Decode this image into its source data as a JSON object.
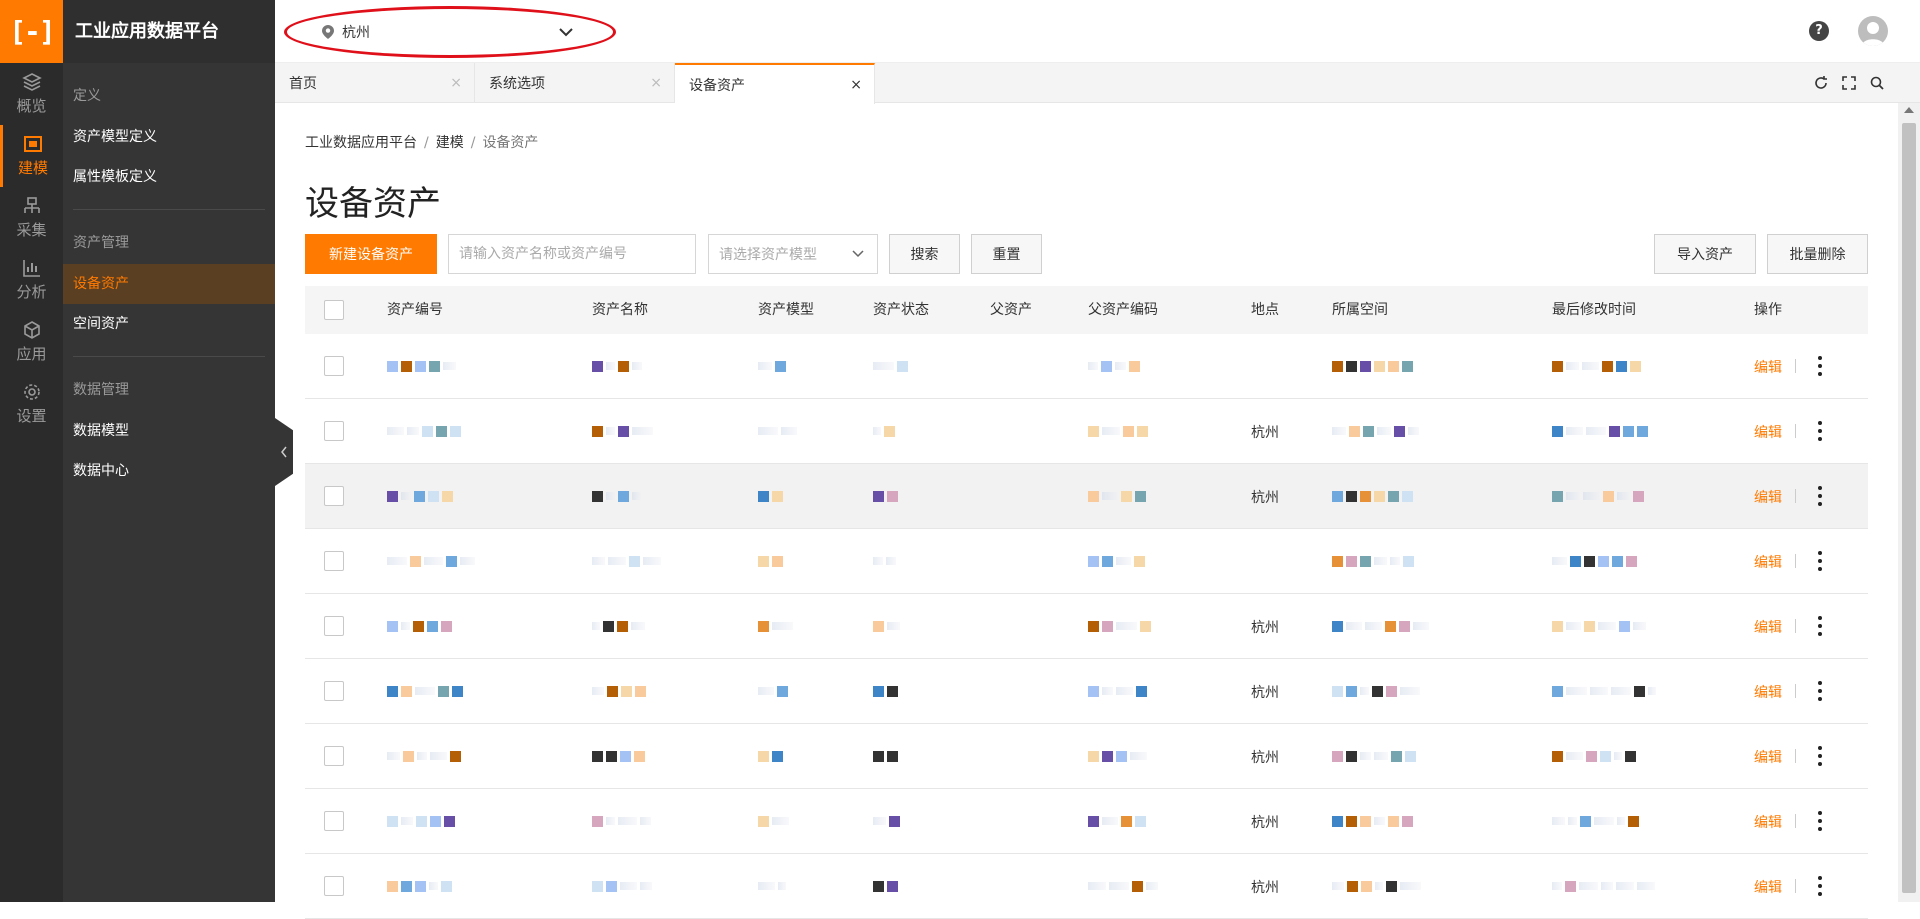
{
  "app": {
    "title": "工业应用数据平台",
    "logo_glyph": "[-]",
    "accent_color": "#ff7a00"
  },
  "rail": {
    "items": [
      {
        "label": "概览",
        "icon": "layers-icon"
      },
      {
        "label": "建模",
        "icon": "model-icon",
        "active": true
      },
      {
        "label": "采集",
        "icon": "collect-icon"
      },
      {
        "label": "分析",
        "icon": "chart-icon"
      },
      {
        "label": "应用",
        "icon": "cube-icon"
      },
      {
        "label": "设置",
        "icon": "gear-icon"
      }
    ]
  },
  "subnav": {
    "groups": [
      {
        "label": "定义",
        "links": [
          "资产模型定义",
          "属性模板定义"
        ]
      },
      {
        "label": "资产管理",
        "links": [
          "设备资产",
          "空间资产"
        ],
        "active": "设备资产"
      },
      {
        "label": "数据管理",
        "links": [
          "数据模型",
          "数据中心"
        ]
      }
    ]
  },
  "header": {
    "city_value": "杭州",
    "help_label": "?",
    "highlight_color": "#e0101a"
  },
  "tabs": [
    {
      "label": "首页",
      "close": "×"
    },
    {
      "label": "系统选项",
      "close": "×"
    },
    {
      "label": "设备资产",
      "close": "×",
      "active": true
    }
  ],
  "breadcrumb": {
    "items": [
      "工业数据应用平台",
      "建模",
      "设备资产"
    ],
    "separator": "/"
  },
  "page": {
    "title": "设备资产"
  },
  "toolbar": {
    "new_button": "新建设备资产",
    "search_placeholder": "请输入资产名称或资产编号",
    "model_placeholder": "请选择资产模型",
    "search_button": "搜索",
    "reset_button": "重置",
    "import_button": "导入资产",
    "batch_delete_button": "批量删除"
  },
  "table": {
    "columns": [
      "资产编号",
      "资产名称",
      "资产模型",
      "资产状态",
      "父资产",
      "父资产编码",
      "地点",
      "所属空间",
      "最后修改时间",
      "操作"
    ],
    "edit_label": "编辑",
    "rows": [
      {
        "location": ""
      },
      {
        "location": "杭州"
      },
      {
        "location": "杭州",
        "hover": true
      },
      {
        "location": ""
      },
      {
        "location": "杭州"
      },
      {
        "location": "杭州"
      },
      {
        "location": "杭州"
      },
      {
        "location": "杭州"
      },
      {
        "location": "杭州"
      }
    ]
  }
}
